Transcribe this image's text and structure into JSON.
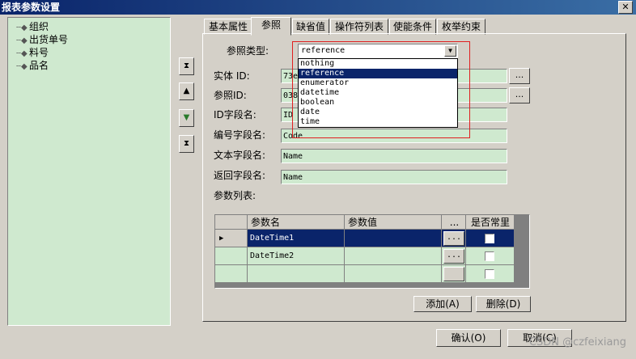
{
  "window": {
    "title": "报表参数设置",
    "close_icon": "close-icon"
  },
  "tree": {
    "items": [
      {
        "label": "组织",
        "icon": "node-icon"
      },
      {
        "label": "出货单号",
        "icon": "node-icon"
      },
      {
        "label": "料号",
        "icon": "node-icon"
      },
      {
        "label": "品名",
        "icon": "node-icon"
      }
    ]
  },
  "side_buttons": {
    "top": "move-top-icon",
    "up": "move-up-icon",
    "down": "move-down-icon",
    "bottom": "move-bottom-icon"
  },
  "tabs": [
    "基本属性",
    "参照",
    "缺省值",
    "操作符列表",
    "使能条件",
    "枚举约束"
  ],
  "form": {
    "ref_type_label": "参照类型:",
    "ref_type_value": "reference",
    "entity_id_label": "实体 ID:",
    "entity_id_value": "73e",
    "ref_id_label": "参照ID:",
    "ref_id_value": "038",
    "id_field_label": "ID字段名:",
    "id_field_value": "ID",
    "code_field_label": "编号字段名:",
    "code_field_value": "Code",
    "text_field_label": "文本字段名:",
    "text_field_value": "Name",
    "return_field_label": "返回字段名:",
    "return_field_value": "Name",
    "params_label": "参数列表:",
    "dots": "..."
  },
  "dropdown": {
    "options": [
      "nothing",
      "reference",
      "enumerator",
      "datetime",
      "boolean",
      "date",
      "time"
    ],
    "selected": "reference"
  },
  "table": {
    "headers": [
      "参数名",
      "参数值",
      "...",
      "是否常里"
    ],
    "rows": [
      {
        "name": "DateTime1",
        "value": "",
        "dots": "...",
        "checked": false
      },
      {
        "name": "DateTime2",
        "value": "",
        "dots": "...",
        "checked": false
      },
      {
        "name": "",
        "value": "",
        "dots": "",
        "checked": false
      }
    ]
  },
  "buttons": {
    "add": "添加(A)",
    "delete": "删除(D)",
    "ok": "确认(O)",
    "cancel": "取消(C)"
  },
  "watermark": "CSDN @czfeixiang"
}
